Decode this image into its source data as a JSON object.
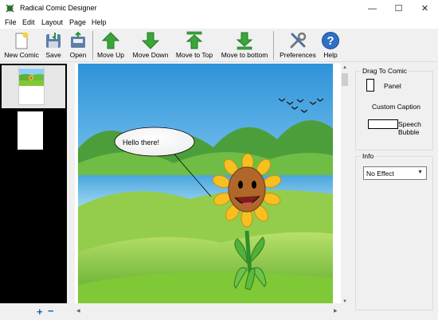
{
  "window": {
    "title": "Radical Comic Designer"
  },
  "menu": [
    "File",
    "Edit",
    "Layout",
    "Page",
    "Help"
  ],
  "toolbar": {
    "new_comic": "New Comic",
    "save": "Save",
    "open": "Open",
    "move_up": "Move Up",
    "move_down": "Move Down",
    "move_to_top": "Move to Top",
    "move_to_bottom": "Move to bottom",
    "preferences": "Preferences",
    "help": "Help"
  },
  "canvas": {
    "speech_text": "Hello there!"
  },
  "drag_to_comic": {
    "title": "Drag To Comic",
    "panel": "Panel",
    "custom_caption": "Custom Caption",
    "speech_bubble_line1": "Speech",
    "speech_bubble_line2": "Bubble"
  },
  "info": {
    "title": "Info",
    "effect_value": "No Effect"
  },
  "colors": {
    "arrow_green": "#3aa63a",
    "accent_blue": "#1c5fb5",
    "sky": "#7cc4ef",
    "grass": "#7fc936"
  },
  "icons": [
    "comic-app-icon",
    "minimize-icon",
    "maximize-icon",
    "close-icon",
    "new-comic-icon",
    "save-icon",
    "open-icon",
    "move-up-icon",
    "move-down-icon",
    "move-to-top-icon",
    "move-to-bottom-icon",
    "preferences-icon",
    "help-icon",
    "add-page-icon",
    "remove-page-icon",
    "panel-icon",
    "speech-bubble-icon"
  ]
}
